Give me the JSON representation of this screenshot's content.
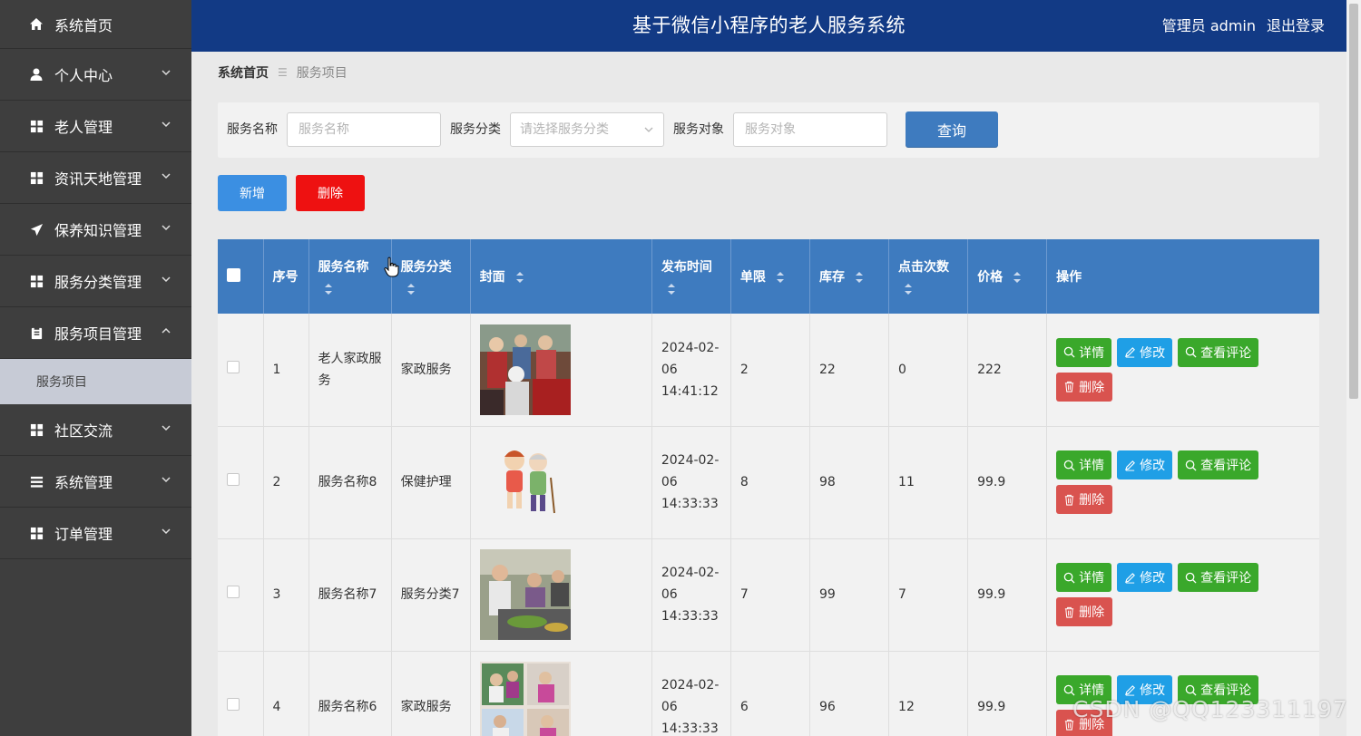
{
  "sidebar": {
    "items": [
      {
        "label": "系统首页",
        "icon": "home-icon"
      },
      {
        "label": "个人中心",
        "icon": "user-icon"
      },
      {
        "label": "老人管理",
        "icon": "grid-icon"
      },
      {
        "label": "资讯天地管理",
        "icon": "grid-icon"
      },
      {
        "label": "保养知识管理",
        "icon": "paper-plane-icon"
      },
      {
        "label": "服务分类管理",
        "icon": "grid-icon"
      },
      {
        "label": "服务项目管理",
        "icon": "clipboard-icon"
      },
      {
        "label": "社区交流",
        "icon": "grid-icon"
      },
      {
        "label": "系统管理",
        "icon": "list-icon"
      },
      {
        "label": "订单管理",
        "icon": "grid-icon"
      }
    ],
    "sub_item": "服务项目"
  },
  "header": {
    "title": "基于微信小程序的老人服务系统",
    "user": "管理员 admin",
    "logout": "退出登录"
  },
  "breadcrumb": {
    "home": "系统首页",
    "current": "服务项目"
  },
  "search": {
    "name_label": "服务名称",
    "name_placeholder": "服务名称",
    "category_label": "服务分类",
    "category_placeholder": "请选择服务分类",
    "target_label": "服务对象",
    "target_placeholder": "服务对象",
    "query_button": "查询"
  },
  "actions": {
    "add": "新增",
    "delete": "删除"
  },
  "table": {
    "headers": {
      "index": "序号",
      "name": "服务名称",
      "category": "服务分类",
      "cover": "封面",
      "time": "发布时间",
      "limit": "单限",
      "stock": "库存",
      "clicks": "点击次数",
      "price": "价格",
      "ops": "操作"
    },
    "rows": [
      {
        "index": "1",
        "name": "老人家政服务",
        "category": "家政服务",
        "time": "2024-02-06 14:41:12",
        "limit": "2",
        "stock": "22",
        "clicks": "0",
        "price": "222"
      },
      {
        "index": "2",
        "name": "服务名称8",
        "category": "保健护理",
        "time": "2024-02-06 14:33:33",
        "limit": "8",
        "stock": "98",
        "clicks": "11",
        "price": "99.9"
      },
      {
        "index": "3",
        "name": "服务名称7",
        "category": "服务分类7",
        "time": "2024-02-06 14:33:33",
        "limit": "7",
        "stock": "99",
        "clicks": "7",
        "price": "99.9"
      },
      {
        "index": "4",
        "name": "服务名称6",
        "category": "家政服务",
        "time": "2024-02-06 14:33:33",
        "limit": "6",
        "stock": "96",
        "clicks": "12",
        "price": "99.9"
      }
    ],
    "op_labels": {
      "detail": "详情",
      "edit": "修改",
      "comment": "查看评论",
      "delete": "删除"
    }
  },
  "watermark": "CSDN @QQ123311197",
  "colors": {
    "sidebar_bg": "#3e3e3e",
    "header_bg": "#123a85",
    "table_header": "#3e7bbf",
    "btn_green": "#3aa82b",
    "btn_blue": "#1f9fe6",
    "btn_red": "#ee1111"
  }
}
